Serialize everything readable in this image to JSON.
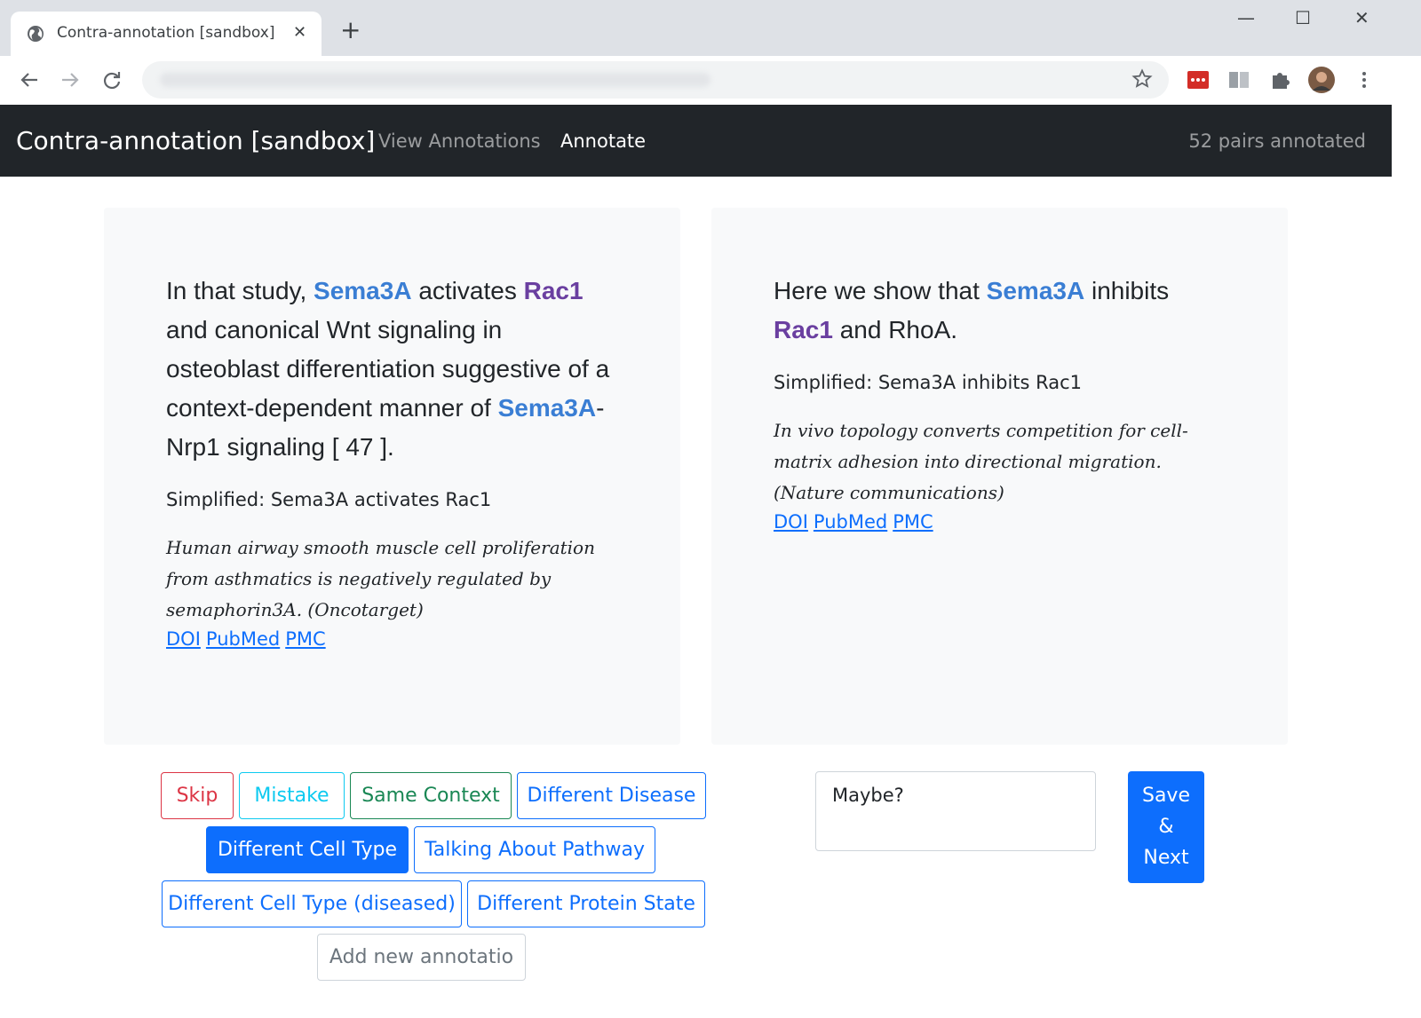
{
  "browser": {
    "tab_title": "Contra-annotation [sandbox]",
    "tab_close": "✕",
    "new_tab": "+",
    "window_controls": {
      "minimize": "—",
      "maximize": "☐",
      "close": "✕"
    }
  },
  "navbar": {
    "brand": "Contra-annotation [sandbox]",
    "links": [
      "View Annotations",
      "Annotate"
    ],
    "active_link": "Annotate",
    "count": "52 pairs annotated"
  },
  "left_card": {
    "sentence_parts": [
      {
        "text": "In that study, ",
        "style": "plain"
      },
      {
        "text": "Sema3A",
        "style": "gene1"
      },
      {
        "text": " activates ",
        "style": "plain"
      },
      {
        "text": "Rac1",
        "style": "gene2"
      },
      {
        "text": " and canonical Wnt signaling in osteoblast differentiation suggestive of a context-dependent manner of ",
        "style": "plain"
      },
      {
        "text": "Sema3A",
        "style": "gene1"
      },
      {
        "text": "-Nrp1 signaling [ 47 ].",
        "style": "plain"
      }
    ],
    "simplified": "Simplified: Sema3A activates Rac1",
    "citation": "Human airway smooth muscle cell proliferation from asthmatics is negatively regulated by semaphorin3A. (Oncotarget)",
    "links": [
      "DOI",
      "PubMed",
      "PMC"
    ]
  },
  "right_card": {
    "sentence_parts": [
      {
        "text": "Here we show that ",
        "style": "plain"
      },
      {
        "text": "Sema3A",
        "style": "gene1"
      },
      {
        "text": " inhibits ",
        "style": "plain"
      },
      {
        "text": "Rac1",
        "style": "gene2"
      },
      {
        "text": " and RhoA.",
        "style": "plain"
      }
    ],
    "simplified": "Simplified: Sema3A inhibits Rac1",
    "citation": "In vivo topology converts competition for cell-matrix adhesion into directional migration. (Nature communications)",
    "links": [
      "DOI",
      "PubMed",
      "PMC"
    ]
  },
  "annotation_buttons": {
    "skip": "Skip",
    "mistake": "Mistake",
    "same_context": "Same Context",
    "different_disease": "Different Disease",
    "different_cell_type": "Different Cell Type",
    "talking_about_pathway": "Talking About Pathway",
    "different_cell_type_diseased": "Different Cell Type (diseased)",
    "different_protein_state": "Different Protein State",
    "add_new_placeholder": "Add new annotatio",
    "selected": "Different Cell Type"
  },
  "notes": {
    "value": "Maybe?"
  },
  "save_button": {
    "line1": "Save",
    "line2": "&",
    "line3": "Next"
  },
  "colors": {
    "gene1": "#3a7ed4",
    "gene2": "#6a3fa0",
    "primary": "#0d6efd",
    "danger": "#dc3545",
    "info": "#0dcaf0",
    "success": "#198754",
    "navbar_bg": "#212529",
    "card_bg": "#f8f9fa"
  }
}
